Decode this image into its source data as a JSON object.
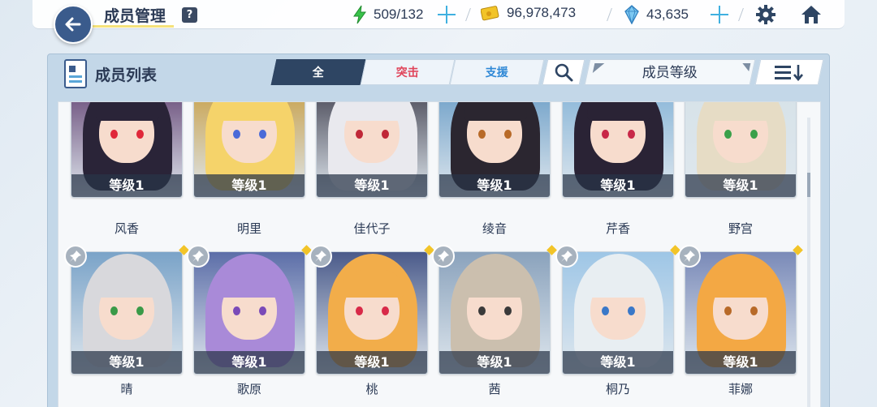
{
  "header": {
    "title": "成员管理",
    "help_label": "?",
    "energy": "509/132",
    "credits": "96,978,473",
    "gems": "43,635"
  },
  "panel": {
    "title": "成员列表",
    "tabs": [
      {
        "label": "全",
        "active": true
      },
      {
        "label": "突击",
        "active": false
      },
      {
        "label": "支援",
        "active": false
      }
    ],
    "sort_label": "成员等级"
  },
  "cards_row1": [
    {
      "name": "风香",
      "level": "等级1",
      "hair": "#2a2438",
      "eye": "#e0283a",
      "bg": "#6a4d7a"
    },
    {
      "name": "明里",
      "level": "等级1",
      "hair": "#f5d36a",
      "eye": "#4a6ad8",
      "bg": "#c8a24e"
    },
    {
      "name": "佳代子",
      "level": "等级1",
      "hair": "#e9e9ee",
      "eye": "#c02838",
      "bg": "#4a4a58"
    },
    {
      "name": "绫音",
      "level": "等级1",
      "hair": "#2b2630",
      "eye": "#b86a28",
      "bg": "#6fa0c8"
    },
    {
      "name": "芹香",
      "level": "等级1",
      "hair": "#2a2335",
      "eye": "#c82848",
      "bg": "#89b6d8"
    },
    {
      "name": "野宫",
      "level": "等级1",
      "hair": "#e6dcc5",
      "eye": "#3aa04a",
      "bg": "#d6e2e8"
    }
  ],
  "cards_row2": [
    {
      "name": "晴",
      "level": "等级1",
      "hair": "#d8d8dc",
      "eye": "#3a9a48",
      "bg": "#7aa3c8"
    },
    {
      "name": "歌原",
      "level": "等级1",
      "hair": "#a98ad8",
      "eye": "#7a4ab8",
      "bg": "#5c6ea8"
    },
    {
      "name": "桃",
      "level": "等级1",
      "hair": "#f2ad4a",
      "eye": "#d82a48",
      "bg": "#4a5a8a"
    },
    {
      "name": "茜",
      "level": "等级1",
      "hair": "#cbbfae",
      "eye": "#3a3a3a",
      "bg": "#8aa2bc"
    },
    {
      "name": "桐乃",
      "level": "等级1",
      "hair": "#e8eef2",
      "eye": "#3a78c8",
      "bg": "#9ec6e6"
    },
    {
      "name": "菲娜",
      "level": "等级1",
      "hair": "#f3a844",
      "eye": "#b86a28",
      "bg": "#7a8ab8"
    }
  ],
  "colors": {
    "accent_dark": "#2e4563",
    "assault": "#e0445a",
    "support": "#2f88d6",
    "plus": "#3fb0e0",
    "energy": "#39c24a",
    "gem": "#3fa6e8",
    "credit": "#f2c428"
  },
  "icons": {
    "back": "arrow-left-icon",
    "energy": "lightning-icon",
    "credit": "credit-card-icon",
    "gem": "gem-icon",
    "settings": "gear-icon",
    "home": "home-icon",
    "search": "search-icon",
    "order": "sort-order-icon",
    "pin": "pin-icon"
  }
}
